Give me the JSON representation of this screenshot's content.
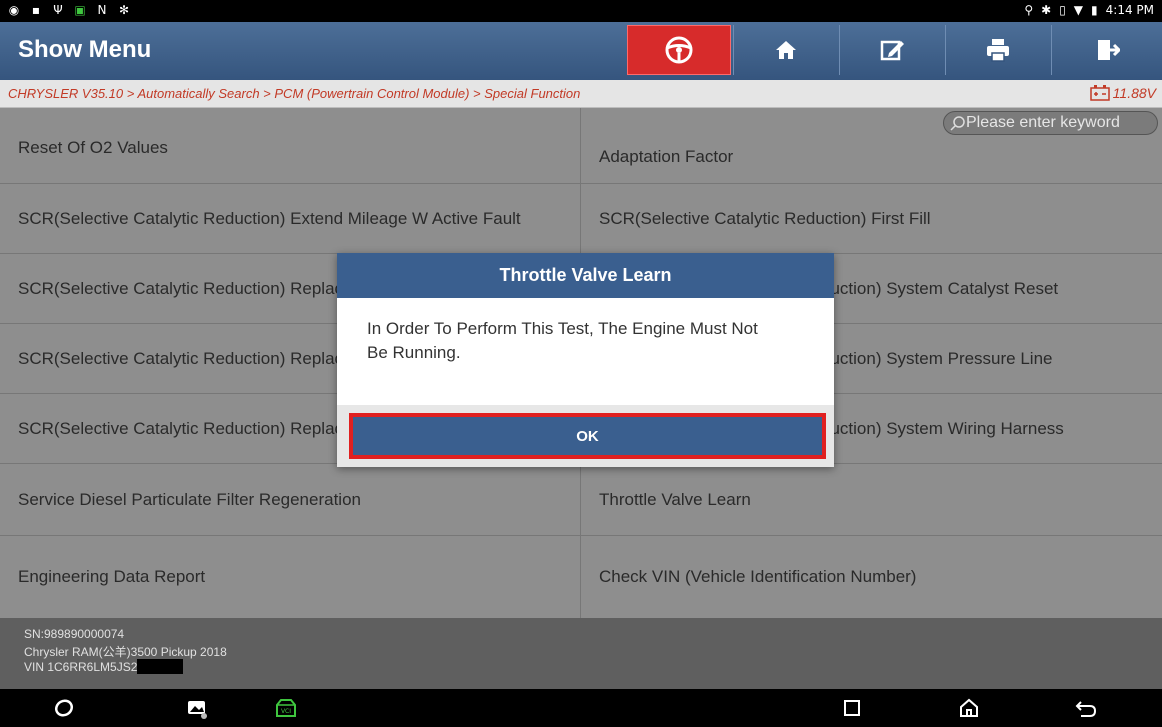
{
  "status_bar": {
    "time": "4:14 PM"
  },
  "header": {
    "title": "Show Menu",
    "toolbar": [
      "steering-wheel-icon",
      "home-icon",
      "edit-icon",
      "print-icon",
      "exit-icon"
    ]
  },
  "breadcrumb": {
    "path": "CHRYSLER V35.10 > Automatically Search > PCM (Powertrain Control Module) > Special Function",
    "voltage": "11.88V"
  },
  "search": {
    "placeholder": "Please enter keyword"
  },
  "functions": [
    [
      "Reset Of O2 Values",
      "Adaptation Factor"
    ],
    [
      "SCR(Selective Catalytic Reduction) Extend Mileage W Active Fault",
      "SCR(Selective Catalytic Reduction) First Fill"
    ],
    [
      "SCR(Selective Catalytic Reduction) Replacement Procedure",
      "duction) System Catalyst Reset"
    ],
    [
      "SCR(Selective Catalytic Reduction) Replacement",
      "duction) System Pressure Line"
    ],
    [
      "SCR(Selective Catalytic Reduction) Replacement",
      "duction) System Wiring Harness"
    ],
    [
      "Service Diesel Particulate Filter Regeneration",
      "Throttle Valve Learn"
    ],
    [
      "Engineering Data Report",
      "Check VIN (Vehicle Identification Number)"
    ]
  ],
  "footer": {
    "sn": "SN:989890000074",
    "vehicle": "Chrysler RAM(公羊)3500 Pickup 2018",
    "vin": "VIN 1C6RR6LM5JS2"
  },
  "dialog": {
    "title": "Throttle Valve Learn",
    "message": "In Order To Perform This Test, The Engine Must Not Be Running.",
    "ok_label": "OK"
  },
  "colors": {
    "header": "#3a5f8f",
    "accent_red": "#d72b2b",
    "breadcrumb_text": "#c23a26"
  }
}
